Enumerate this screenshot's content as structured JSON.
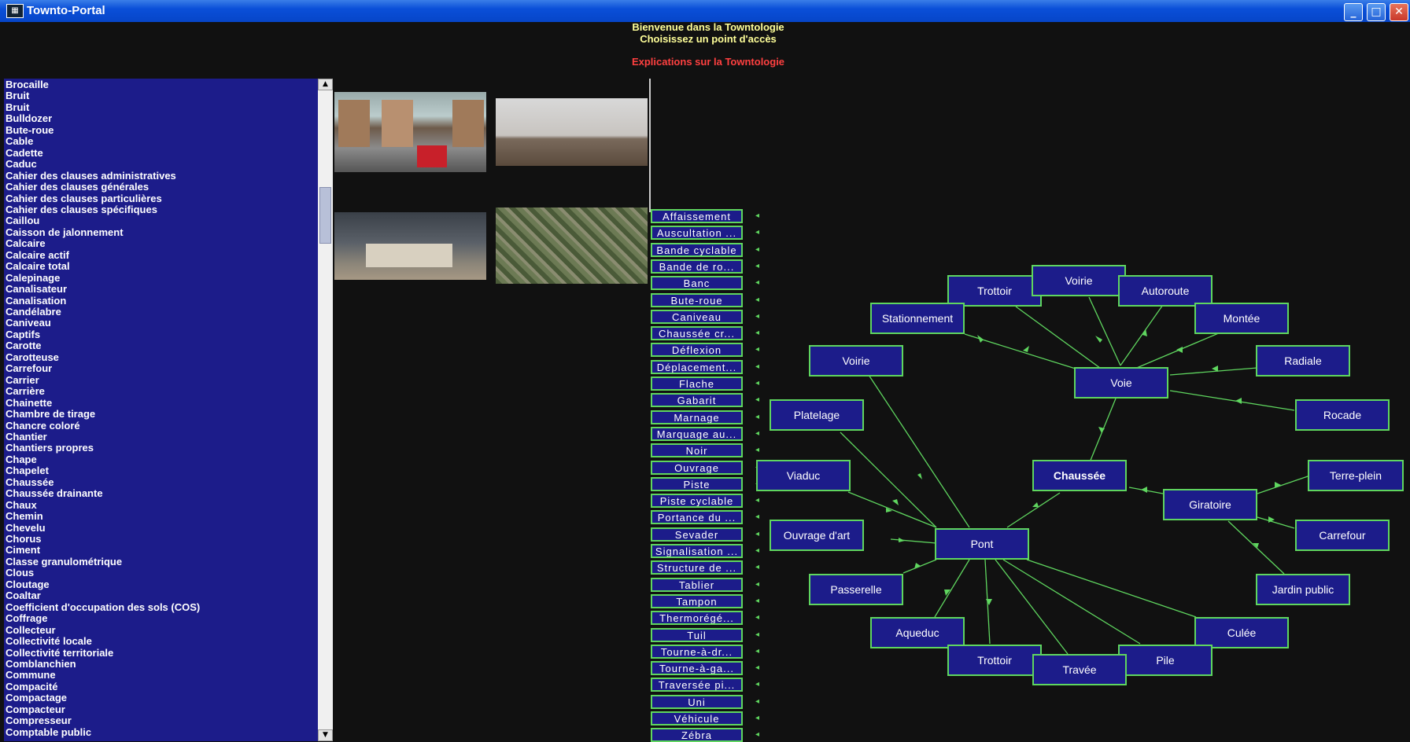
{
  "window": {
    "title": "Townto-Portal",
    "minimize": "_",
    "maximize": "□",
    "close": "✕"
  },
  "header": {
    "line1": "Bienvenue dans la Towntologie",
    "line2": "Choisissez un point d'accès",
    "link": "Explications sur la Towntologie"
  },
  "terms": [
    "Brocaille",
    "Bruit",
    "Bruit",
    "Bulldozer",
    "Bute-roue",
    "Cable",
    "Cadette",
    "Caduc",
    "Cahier des clauses administratives",
    "Cahier des clauses générales",
    "Cahier des clauses particulières",
    "Cahier des clauses spécifiques",
    "Caillou",
    "Caisson de jalonnement",
    "Calcaire",
    "Calcaire actif",
    "Calcaire total",
    "Calepinage",
    "Canalisateur",
    "Canalisation",
    "Candélabre",
    "Caniveau",
    "Captifs",
    "Carotte",
    "Carotteuse",
    "Carrefour",
    "Carrier",
    "Carrière",
    "Chainette",
    "Chambre de tirage",
    "Chancre coloré",
    "Chantier",
    "Chantiers propres",
    "Chape",
    "Chapelet",
    "Chaussée",
    "Chaussée drainante",
    "Chaux",
    "Chemin",
    "Chevelu",
    "Chorus",
    "Ciment",
    "Classe granulométrique",
    "Clous",
    "Cloutage",
    "Coaltar",
    "Coefficient d'occupation des sols (COS)",
    "Coffrage",
    "Collecteur",
    "Collectivité locale",
    "Collectivité territoriale",
    "Comblanchien",
    "Commune",
    "Compacité",
    "Compactage",
    "Compacteur",
    "Compresseur",
    "Comptable public"
  ],
  "related_terms": [
    "Affaissement",
    "Auscultation ...",
    "Bande cyclable",
    "Bande de ro...",
    "Banc",
    "Bute-roue",
    "Caniveau",
    "Chaussée cr...",
    "Déflexion",
    "Déplacement...",
    "Flache",
    "Gabarit",
    "Marnage",
    "Marquage au...",
    "Noir",
    "Ouvrage",
    "Piste",
    "Piste cyclable",
    "Portance du ...",
    "Sevader",
    "Signalisation ...",
    "Structure de ...",
    "Tablier",
    "Tampon",
    "Thermorégé...",
    "Tuil",
    "Tourne-à-dr...",
    "Tourne-à-ga...",
    "Traversée pi...",
    "Uni",
    "Véhicule",
    "Zébra"
  ],
  "graph": {
    "center": "Chaussée",
    "nodes": [
      "Trottoir",
      "Voirie",
      "Autoroute",
      "Stationnement",
      "Montée",
      "Voirie",
      "Voie",
      "Radiale",
      "Platelage",
      "Rocade",
      "Viaduc",
      "Chaussée",
      "Terre-plein",
      "Giratoire",
      "Ouvrage d'art",
      "Pont",
      "Carrefour",
      "Passerelle",
      "Jardin public",
      "Aqueduc",
      "Culée",
      "Trottoir",
      "Pile",
      "Travée"
    ]
  },
  "colors": {
    "list_bg": "#1c1c8a",
    "node_border": "#5fd65f",
    "title_text": "#ffff99",
    "link_text": "#ff4040"
  }
}
